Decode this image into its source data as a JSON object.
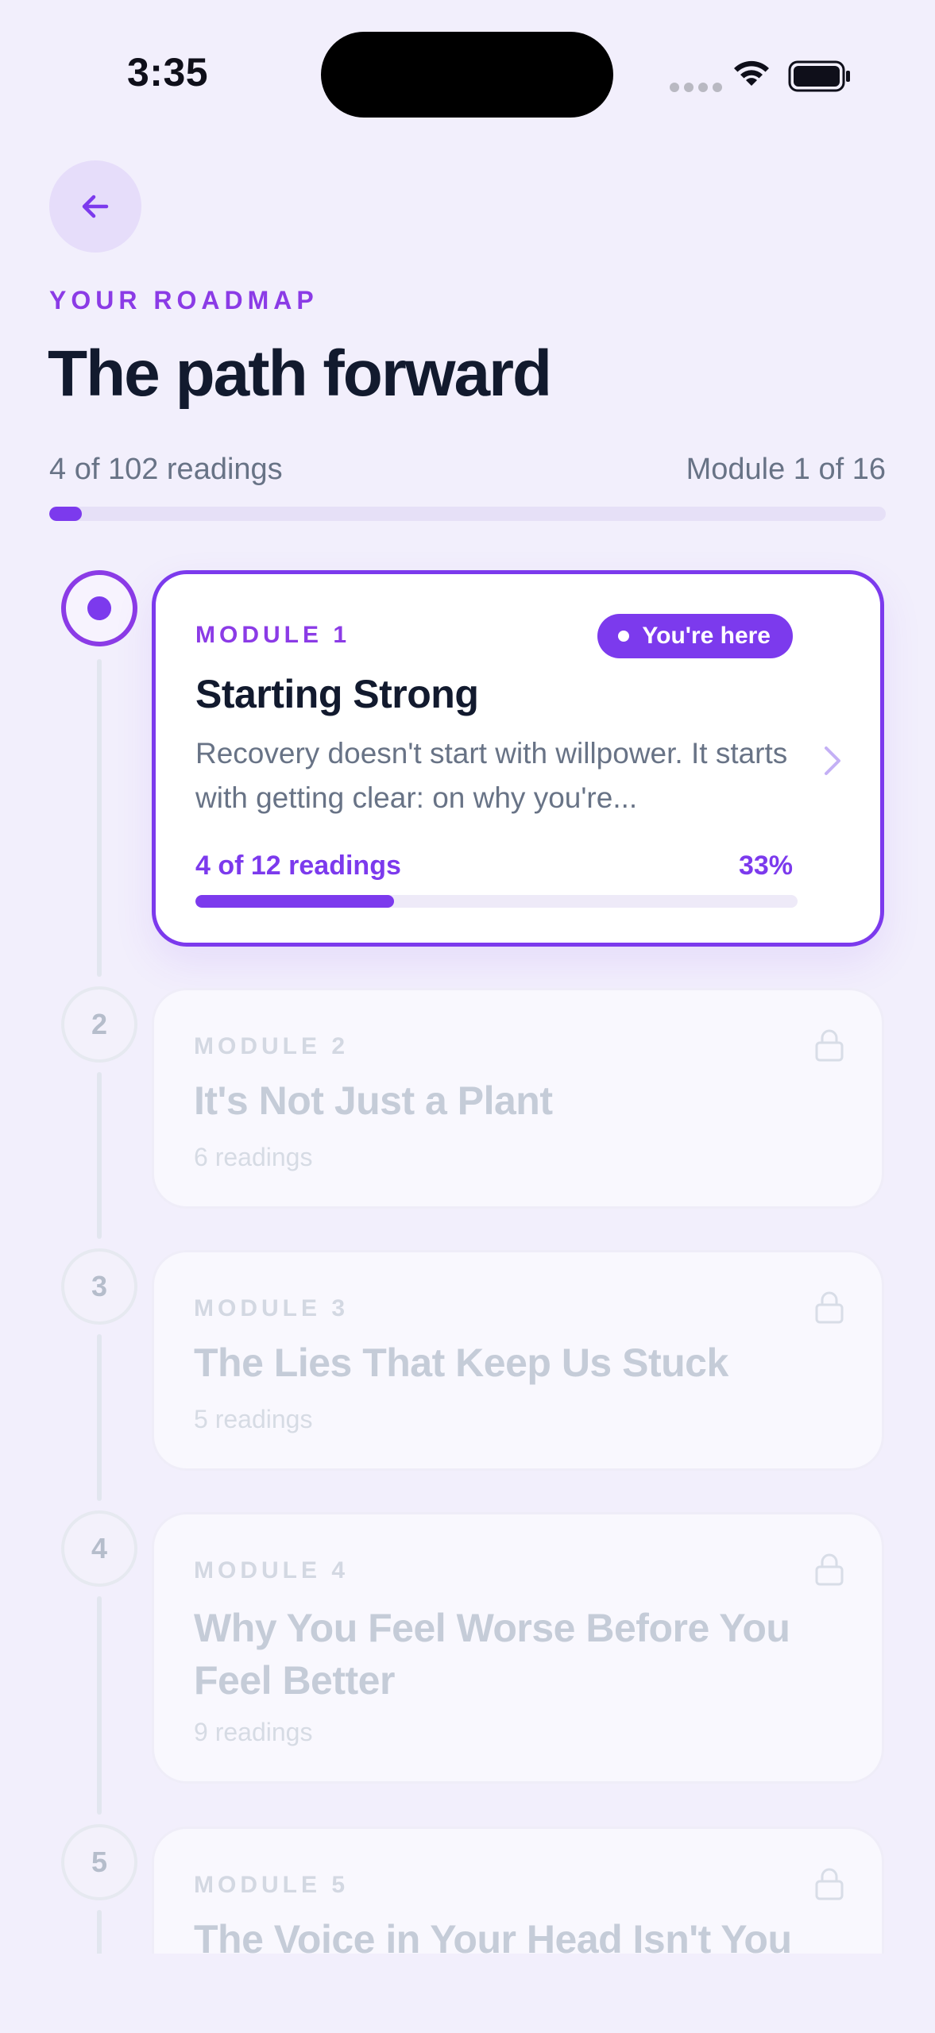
{
  "status_bar": {
    "time": "3:35"
  },
  "header": {
    "back_icon": "arrow-left-icon",
    "eyebrow": "YOUR ROADMAP",
    "title": "The path forward",
    "readings_progress": "4 of 102 readings",
    "module_progress": "Module 1 of 16",
    "overall_progress_fraction": 0.039
  },
  "colors": {
    "accent": "#7C3AED",
    "eyebrow": "#8B3BE6",
    "title": "#121A2E",
    "muted": "#687386",
    "locked_text": "#C5CCD8",
    "background": "#F2EFFC"
  },
  "modules": [
    {
      "label": "MODULE 1",
      "title": "Starting Strong",
      "badge": "You're here",
      "description": "Recovery doesn't start with willpower. It starts with getting clear: on why you're...",
      "progress_text": "4 of 12 readings",
      "progress_pct": "33%",
      "progress_fraction": 0.33,
      "state": "active"
    },
    {
      "number": "2",
      "label": "MODULE 2",
      "title": "It's Not Just a Plant",
      "readings": "6 readings",
      "state": "locked"
    },
    {
      "number": "3",
      "label": "MODULE 3",
      "title": "The Lies That Keep Us Stuck",
      "readings": "5 readings",
      "state": "locked"
    },
    {
      "number": "4",
      "label": "MODULE 4",
      "title": "Why You Feel Worse Before You Feel Better",
      "readings": "9 readings",
      "state": "locked"
    },
    {
      "number": "5",
      "label": "MODULE 5",
      "title": "The Voice in Your Head Isn't You",
      "state": "locked"
    }
  ]
}
